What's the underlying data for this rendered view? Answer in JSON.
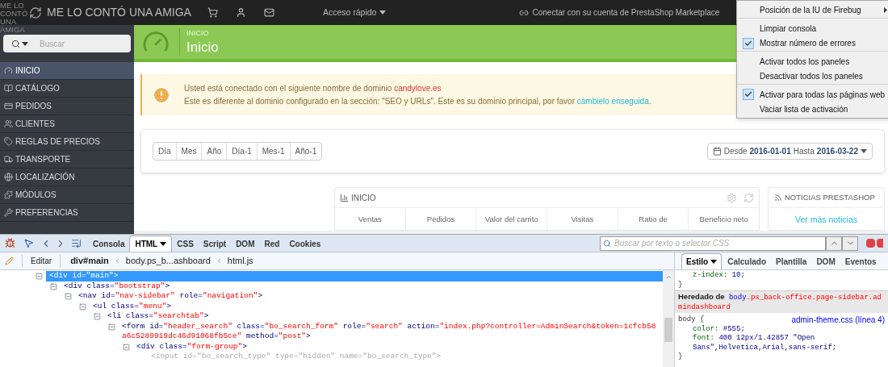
{
  "topbar": {
    "shop_name": "ME LO CONTÓ UNA AMIGA",
    "logo_alt": "ME LO CONTÓ UNA AMIGA",
    "quick_access": "Acceso rápido",
    "marketplace": "Conectar con su cuenta de PrestaShop Marketplace"
  },
  "sidebar": {
    "search_placeholder": "Buscar",
    "items": [
      {
        "label": "INICIO",
        "selected": true
      },
      {
        "label": "CATÁLOGO",
        "selected": false
      },
      {
        "label": "PEDIDOS",
        "selected": false
      },
      {
        "label": "CLIENTES",
        "selected": false
      },
      {
        "label": "REGLAS DE PRECIOS",
        "selected": false
      },
      {
        "label": "TRANSPORTE",
        "selected": false
      },
      {
        "label": "LOCALIZACIÓN",
        "selected": false
      },
      {
        "label": "MÓDULOS",
        "selected": false
      },
      {
        "label": "PREFERENCIAS",
        "selected": false
      }
    ]
  },
  "page_header": {
    "breadcrumb": "INICIO",
    "title": "Inicio"
  },
  "alert": {
    "line_1": "Usted está conectado con el siguiente nombre de dominio",
    "domain": "candylove.es",
    "line_2": "Este es diferente al dominio configurado en la sección: \"SEO y URLs\". Este es su dominio principal, por favor",
    "link": "cámbielo enseguida",
    "end": "."
  },
  "period_buttons": [
    "Día",
    "Mes",
    "Año",
    "Día-1",
    "Mes-1",
    "Año-1"
  ],
  "date_range": {
    "from_label": "Desde",
    "from": "2016-01-01",
    "to_label": "Hasta",
    "to": "2016-03-22"
  },
  "dashboard_panel": {
    "title": "INICIO",
    "columns": [
      "Ventas",
      "Pedidos",
      "Valor del carrito",
      "Visitas",
      "Ratio de",
      "Beneficio neto"
    ]
  },
  "news_panel": {
    "title": "NOTICIAS PRESTASHOP",
    "link": "Ver más noticias"
  },
  "firebug_menu": [
    {
      "label": "Posición de la IU de Firebug",
      "checked": false,
      "submenu": true,
      "separator_after": true
    },
    {
      "label": "Limpiar consola",
      "checked": false,
      "submenu": false,
      "separator_after": false
    },
    {
      "label": "Mostrar número de errores",
      "checked": true,
      "submenu": false,
      "separator_after": true
    },
    {
      "label": "Activar todos los paneles",
      "checked": false,
      "submenu": false,
      "separator_after": false
    },
    {
      "label": "Desactivar todos los paneles",
      "checked": false,
      "submenu": false,
      "separator_after": true
    },
    {
      "label": "Activar para todas las páginas web",
      "checked": true,
      "submenu": false,
      "separator_after": false
    },
    {
      "label": "Vaciar lista de activación",
      "checked": false,
      "submenu": false,
      "separator_after": false
    }
  ],
  "firebug": {
    "tabs": [
      {
        "label": "Consola",
        "selected": false,
        "menu": false
      },
      {
        "label": "HTML",
        "selected": true,
        "menu": true
      },
      {
        "label": "CSS",
        "selected": false,
        "menu": false
      },
      {
        "label": "Script",
        "selected": false,
        "menu": false
      },
      {
        "label": "DOM",
        "selected": false,
        "menu": false
      },
      {
        "label": "Red",
        "selected": false,
        "menu": false
      },
      {
        "label": "Cookies",
        "selected": false,
        "menu": false
      }
    ],
    "search_placeholder": "Buscar por texto o selector CSS",
    "edit_button": "Editar",
    "breadcrumbs": [
      {
        "label": "div#main",
        "selected": true
      },
      {
        "label": "body.ps_b...ashboard",
        "selected": false
      },
      {
        "label": "html.js",
        "selected": false
      }
    ],
    "html_tree": [
      {
        "code": "<div id=\"main\">",
        "selected": true,
        "muted": false,
        "children": [
          {
            "code": "<div class=\"bootstrap\">",
            "selected": false,
            "muted": false,
            "children": [
              {
                "code": "<nav id=\"nav-sidebar\" role=\"navigation\">",
                "selected": false,
                "muted": false,
                "children": [
                  {
                    "code": "<ul class=\"menu\">",
                    "selected": false,
                    "muted": false,
                    "children": [
                      {
                        "code": "<li class=\"searchtab\">",
                        "selected": false,
                        "muted": false,
                        "children": [
                          {
                            "code": "<form id=\"header_search\" class=\"bo_search_form\" role=\"search\" action=\"index.php?controller=AdminSearch&token=1cfcb58a6c5289919dc46d91068fb5ce\" method=\"post\">",
                            "selected": false,
                            "muted": false,
                            "children": [
                              {
                                "code": "<div class=\"form-group\">",
                                "selected": false,
                                "muted": false,
                                "children": [
                                  {
                                    "code": "<input id=\"bo_search_type\" type=\"hidden\" name=\"bo_search_type\">",
                                    "selected": false,
                                    "muted": true
                                  }
                                ]
                              }
                            ]
                          }
                        ]
                      }
                    ]
                  }
                ]
              }
            ]
          }
        ]
      }
    ],
    "side_tabs": [
      {
        "label": "Estilo",
        "selected": true,
        "menu": true
      },
      {
        "label": "Calculado",
        "selected": false,
        "menu": false
      },
      {
        "label": "Plantilla",
        "selected": false,
        "menu": false
      },
      {
        "label": "DOM",
        "selected": false,
        "menu": false
      },
      {
        "label": "Eventos",
        "selected": false,
        "menu": false
      }
    ],
    "style_lines": [
      {
        "kind": "prop",
        "name": "z-index:",
        "value": "10;"
      },
      {
        "kind": "close",
        "text": "}"
      },
      {
        "kind": "inherited",
        "label": "Heredado de",
        "selector_element": "body",
        "selector_rest": ".ps_back-office.page-sidebar.admindashboard"
      },
      {
        "kind": "rule",
        "selector": "body {",
        "source": "admin-theme.css (línea 4)"
      },
      {
        "kind": "prop",
        "name": "color:",
        "value": "#555;"
      },
      {
        "kind": "prop",
        "name": "font:",
        "value": "400 12px/1.42857 \"Open Sans\",Helvetica,Arial,sans-serif;"
      },
      {
        "kind": "close",
        "text": "}"
      }
    ]
  }
}
